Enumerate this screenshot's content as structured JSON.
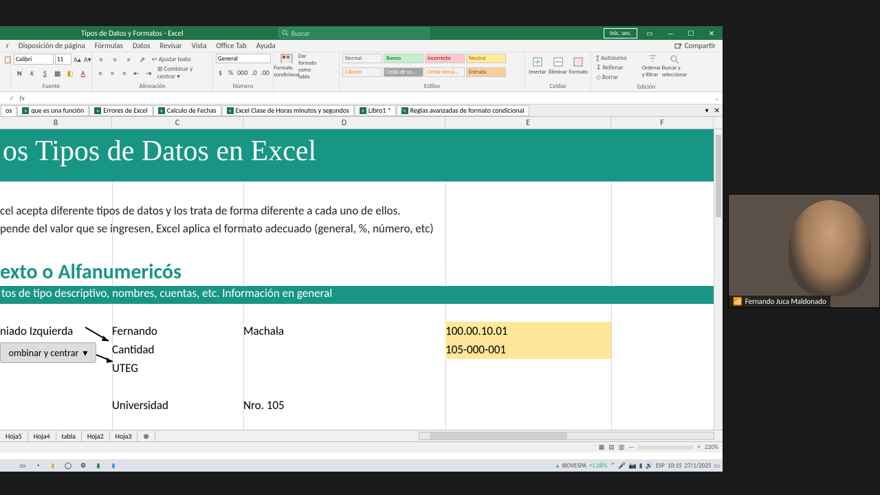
{
  "titlebar": {
    "title": "Tipos de Datos y Formatos   -  Excel",
    "search_placeholder": "Buscar",
    "login": "Inic. ses."
  },
  "menu": {
    "items": [
      "r",
      "Disposición de página",
      "Fórmulas",
      "Datos",
      "Revisar",
      "Vista",
      "Office Tab",
      "Ayuda"
    ],
    "share": "Compartir"
  },
  "ribbon": {
    "font_name": "Calibri",
    "font_size": "11",
    "wrap": "Ajustar texto",
    "merge": "Combinar y centrar",
    "number_fmt": "General",
    "cond": "Formato condicional",
    "astable": "Dar formato como tabla",
    "styles": {
      "normal": "Normal",
      "bueno": "Bueno",
      "incorrecto": "Incorrecto",
      "neutral": "Neutral",
      "calculo": "Cálculo",
      "celdade": "Celda de co...",
      "celdavin": "Celda vincul...",
      "entrada": "Entrada"
    },
    "insertar": "Insertar",
    "eliminar": "Eliminar",
    "formato": "Formato",
    "autosuma": "Autosuma",
    "rellenar": "Rellenar",
    "borrar": "Borrar",
    "ordenar": "Ordenar y filtrar",
    "buscar": "Buscar y seleccionar",
    "sec_fuente": "Fuente",
    "sec_align": "Alineación",
    "sec_num": "Número",
    "sec_estilos": "Estilos",
    "sec_celdas": "Celdas",
    "sec_edicion": "Edición"
  },
  "wbtabs": [
    "os",
    "que es una función",
    "Errores de Excel",
    "Calculo de Fechas",
    "Excel Clase de Horas minutos y segundos",
    "Libro1 *",
    "Reglas avanzadas de formato condicional"
  ],
  "columns": [
    "B",
    "C",
    "D",
    "E",
    "F"
  ],
  "content": {
    "banner1": "os Tipos de Datos en Excel",
    "line1": "cel acepta diferente tipos de datos y los trata de forma diferente a cada uno de ellos.",
    "line2": "pende del valor que se ingresen, Excel aplica el formato adecuado (general, %, número, etc)",
    "heading2": "exto o Alfanumericós",
    "banner2": "tos de tipo descriptivo, nombres, cuentas, etc. Información en general",
    "cellB1": "niado Izquierda",
    "cellC1": "Fernando",
    "cellD1": "Machala",
    "cellE1": "100.00.10.01",
    "cellC2": "Cantidad",
    "cellE2": "105-000-001",
    "cellC3": "UTEG",
    "cellC5": "Universidad",
    "cellD5": "Nro. 105",
    "callout": "ombinar y centrar"
  },
  "sheettabs": [
    "Hoja5",
    "Hoja4",
    "tabla",
    "Hoja2",
    "Hoja3"
  ],
  "status": {
    "zoom": "220%"
  },
  "webcam": {
    "name": "Fernando Juca Maldonado"
  },
  "taskbar": {
    "stock": "IBOVESPA",
    "stock_chg": "+1,08%",
    "lang": "ESP",
    "time": "10:15",
    "date": "27/1/2025"
  }
}
